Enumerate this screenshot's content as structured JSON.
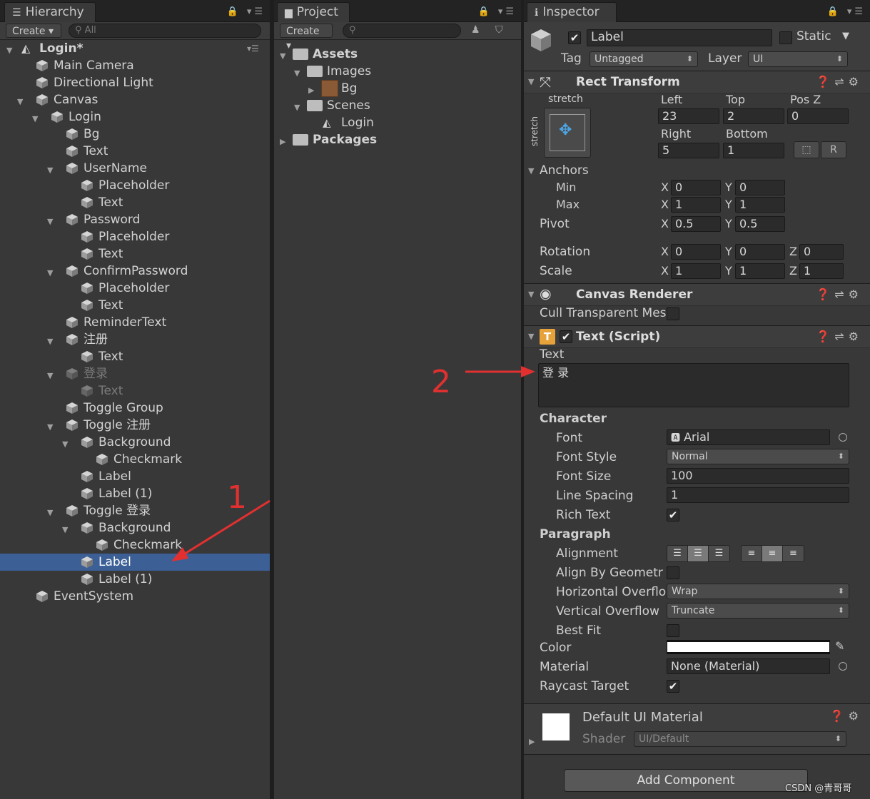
{
  "hierarchy": {
    "tab": "Hierarchy",
    "create": "Create",
    "search_placeholder": "All",
    "scene": "Login*",
    "items": [
      {
        "label": "Main Camera"
      },
      {
        "label": "Directional Light"
      },
      {
        "label": "Canvas"
      },
      {
        "label": "Login"
      },
      {
        "label": "Bg"
      },
      {
        "label": "Text"
      },
      {
        "label": "UserName"
      },
      {
        "label": "Placeholder"
      },
      {
        "label": "Text"
      },
      {
        "label": "Password"
      },
      {
        "label": "Placeholder"
      },
      {
        "label": "Text"
      },
      {
        "label": "ConfirmPassword"
      },
      {
        "label": "Placeholder"
      },
      {
        "label": "Text"
      },
      {
        "label": "ReminderText"
      },
      {
        "label": "注册"
      },
      {
        "label": "Text"
      },
      {
        "label": "登录"
      },
      {
        "label": "Text"
      },
      {
        "label": "Toggle Group"
      },
      {
        "label": "Toggle 注册"
      },
      {
        "label": "Background"
      },
      {
        "label": "Checkmark"
      },
      {
        "label": "Label"
      },
      {
        "label": "Label (1)"
      },
      {
        "label": "Toggle 登录"
      },
      {
        "label": "Background"
      },
      {
        "label": "Checkmark"
      },
      {
        "label": "Label"
      },
      {
        "label": "Label (1)"
      },
      {
        "label": "EventSystem"
      }
    ]
  },
  "project": {
    "tab": "Project",
    "create": "Create",
    "items": [
      {
        "label": "Assets"
      },
      {
        "label": "Images"
      },
      {
        "label": "Bg"
      },
      {
        "label": "Scenes"
      },
      {
        "label": "Login"
      },
      {
        "label": "Packages"
      }
    ]
  },
  "inspector": {
    "tab": "Inspector",
    "name": "Label",
    "static": "Static",
    "tag_label": "Tag",
    "tag": "Untagged",
    "layer_label": "Layer",
    "layer": "UI",
    "rect": {
      "title": "Rect Transform",
      "stretch_top": "stretch",
      "stretch_side": "stretch",
      "left_label": "Left",
      "top_label": "Top",
      "posz_label": "Pos Z",
      "left": "23",
      "top": "2",
      "posz": "0",
      "right_label": "Right",
      "bottom_label": "Bottom",
      "right": "5",
      "bottom": "1",
      "r_btn": "R",
      "anchors": "Anchors",
      "min": "Min",
      "max": "Max",
      "min_x": "0",
      "min_y": "0",
      "max_x": "1",
      "max_y": "1",
      "pivot": "Pivot",
      "pivot_x": "0.5",
      "pivot_y": "0.5",
      "rotation": "Rotation",
      "rot_x": "0",
      "rot_y": "0",
      "rot_z": "0",
      "scale": "Scale",
      "scale_x": "1",
      "scale_y": "1",
      "scale_z": "1",
      "x": "X",
      "y": "Y",
      "z": "Z"
    },
    "canvas_renderer": {
      "title": "Canvas Renderer",
      "cull": "Cull Transparent Mes"
    },
    "text_script": {
      "title": "Text (Script)",
      "text_label": "Text",
      "text_value": "登 录",
      "character": "Character",
      "font_label": "Font",
      "font": "Arial",
      "font_style_label": "Font Style",
      "font_style": "Normal",
      "font_size_label": "Font Size",
      "font_size": "100",
      "line_spacing_label": "Line Spacing",
      "line_spacing": "1",
      "rich_text_label": "Rich Text",
      "paragraph": "Paragraph",
      "alignment_label": "Alignment",
      "align_geom_label": "Align By Geometr",
      "h_overflow_label": "Horizontal Overflo",
      "h_overflow": "Wrap",
      "v_overflow_label": "Vertical Overflow",
      "v_overflow": "Truncate",
      "best_fit_label": "Best Fit",
      "color_label": "Color",
      "material_label": "Material",
      "material": "None (Material)",
      "raycast_label": "Raycast Target"
    },
    "material": {
      "title": "Default UI Material",
      "shader_label": "Shader",
      "shader": "UI/Default"
    },
    "add_component": "Add Component"
  },
  "annotations": {
    "one": "1",
    "two": "2"
  },
  "watermark": "CSDN @青哥哥"
}
